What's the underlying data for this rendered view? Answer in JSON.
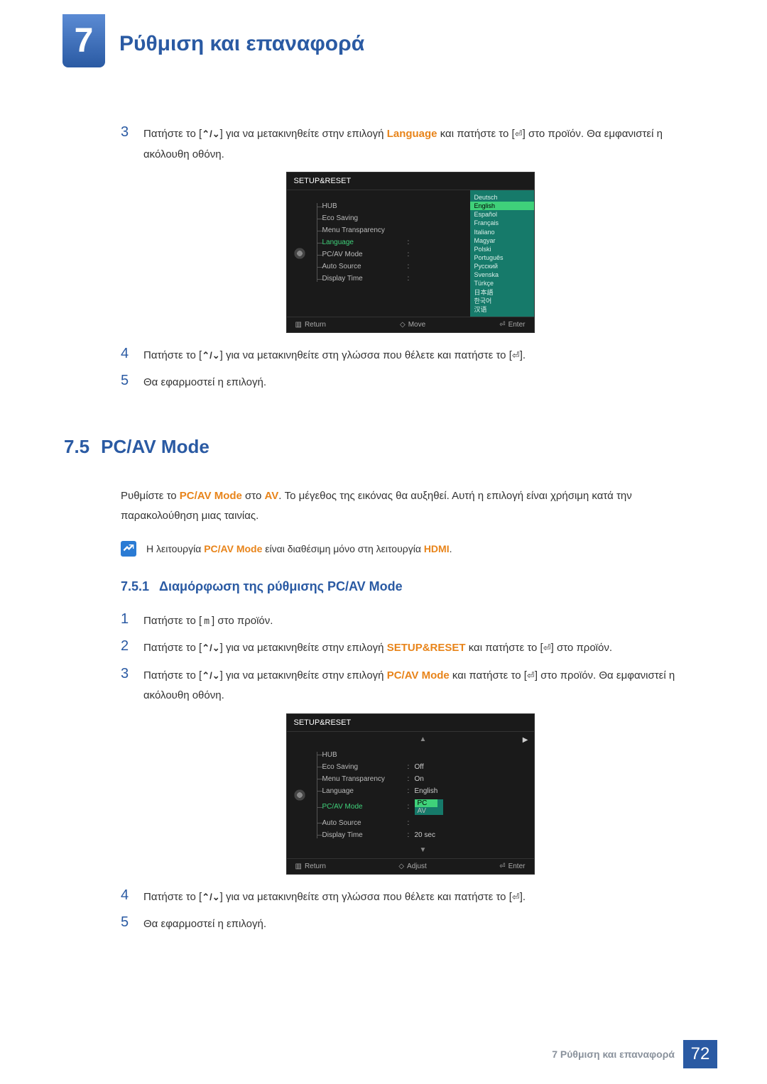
{
  "chapter": {
    "number": "7",
    "title": "Ρύθμιση και επαναφορά"
  },
  "section1": {
    "step3": {
      "num": "3",
      "t1": "Πατήστε το [",
      "arrows": "⌃/⌄",
      "t2": "] για να μετακινηθείτε στην επιλογή ",
      "kw": "Language",
      "t3": " και πατήστε το [",
      "enter": "⏎",
      "t4": "] στο προϊόν. Θα εμφανιστεί η ακόλουθη οθόνη."
    },
    "step4": {
      "num": "4",
      "t1": "Πατήστε το [",
      "arrows": "⌃/⌄",
      "t2": "] για να μετακινηθείτε στη γλώσσα που θέλετε και πατήστε το [",
      "enter": "⏎",
      "t3": "]."
    },
    "step5": {
      "num": "5",
      "text": "Θα εφαρμοστεί η επιλογή."
    }
  },
  "osd1": {
    "title": "SETUP&RESET",
    "menu": [
      "HUB",
      "Eco Saving",
      "Menu Transparency",
      "Language",
      "PC/AV Mode",
      "Auto Source",
      "Display Time"
    ],
    "selected": "Language",
    "langs_top": "Deutsch",
    "langs_sel": "English",
    "langs": [
      "Español",
      "Français",
      "Italiano",
      "Magyar",
      "Polski",
      "Português",
      "Русский",
      "Svenska",
      "Türkçe",
      "日本語",
      "한국어",
      "汉语"
    ],
    "footer": {
      "return": "Return",
      "move": "Move",
      "enter": "Enter"
    }
  },
  "section75": {
    "num": "7.5",
    "title": "PC/AV Mode",
    "para_a": "Ρυθμίστε το ",
    "para_kw1": "PC/AV Mode",
    "para_b": " στο ",
    "para_kw2": "AV",
    "para_c": ". Το μέγεθος της εικόνας θα αυξηθεί. Αυτή η επιλογή είναι χρήσιμη κατά την παρακολούθηση μιας ταινίας.",
    "note_a": "Η λειτουργία ",
    "note_kw1": "PC/AV Mode",
    "note_b": " είναι διαθέσιμη μόνο στη λειτουργία ",
    "note_kw2": "HDMI",
    "note_c": "."
  },
  "subsection751": {
    "num": "7.5.1",
    "title": "Διαμόρφωση της ρύθμισης PC/AV Mode",
    "step1": {
      "num": "1",
      "t1": "Πατήστε το [",
      "m": "m",
      "t2": "] στο προϊόν."
    },
    "step2": {
      "num": "2",
      "t1": "Πατήστε το [",
      "arrows": "⌃/⌄",
      "t2": "] για να μετακινηθείτε στην επιλογή ",
      "kw": "SETUP&RESET",
      "t3": " και πατήστε το [",
      "enter": "⏎",
      "t4": "] στο προϊόν."
    },
    "step3": {
      "num": "3",
      "t1": "Πατήστε το [",
      "arrows": "⌃/⌄",
      "t2": "] για να μετακινηθείτε στην επιλογή ",
      "kw": "PC/AV Mode",
      "t3": " και πατήστε το [",
      "enter": "⏎",
      "t4": "] στο προϊόν. Θα εμφανιστεί η ακόλουθη οθόνη."
    },
    "step4": {
      "num": "4",
      "t1": "Πατήστε το [",
      "arrows": "⌃/⌄",
      "t2": "] για να μετακινηθείτε στη γλώσσα που θέλετε και πατήστε το [",
      "enter": "⏎",
      "t3": "]."
    },
    "step5": {
      "num": "5",
      "text": "Θα εφαρμοστεί η επιλογή."
    }
  },
  "osd2": {
    "title": "SETUP&RESET",
    "rows": [
      {
        "label": "HUB",
        "val": ""
      },
      {
        "label": "Eco Saving",
        "val": "Off"
      },
      {
        "label": "Menu Transparency",
        "val": "On"
      },
      {
        "label": "Language",
        "val": "English"
      },
      {
        "label": "PC/AV Mode",
        "val": ""
      },
      {
        "label": "Auto Source",
        "val": ""
      },
      {
        "label": "Display Time",
        "val": "20 sec"
      }
    ],
    "selected": "PC/AV Mode",
    "dropdown": {
      "sel": "PC",
      "other": "AV"
    },
    "footer": {
      "return": "Return",
      "adjust": "Adjust",
      "enter": "Enter"
    }
  },
  "footer": {
    "text": "7 Ρύθμιση και επαναφορά",
    "page": "72"
  }
}
